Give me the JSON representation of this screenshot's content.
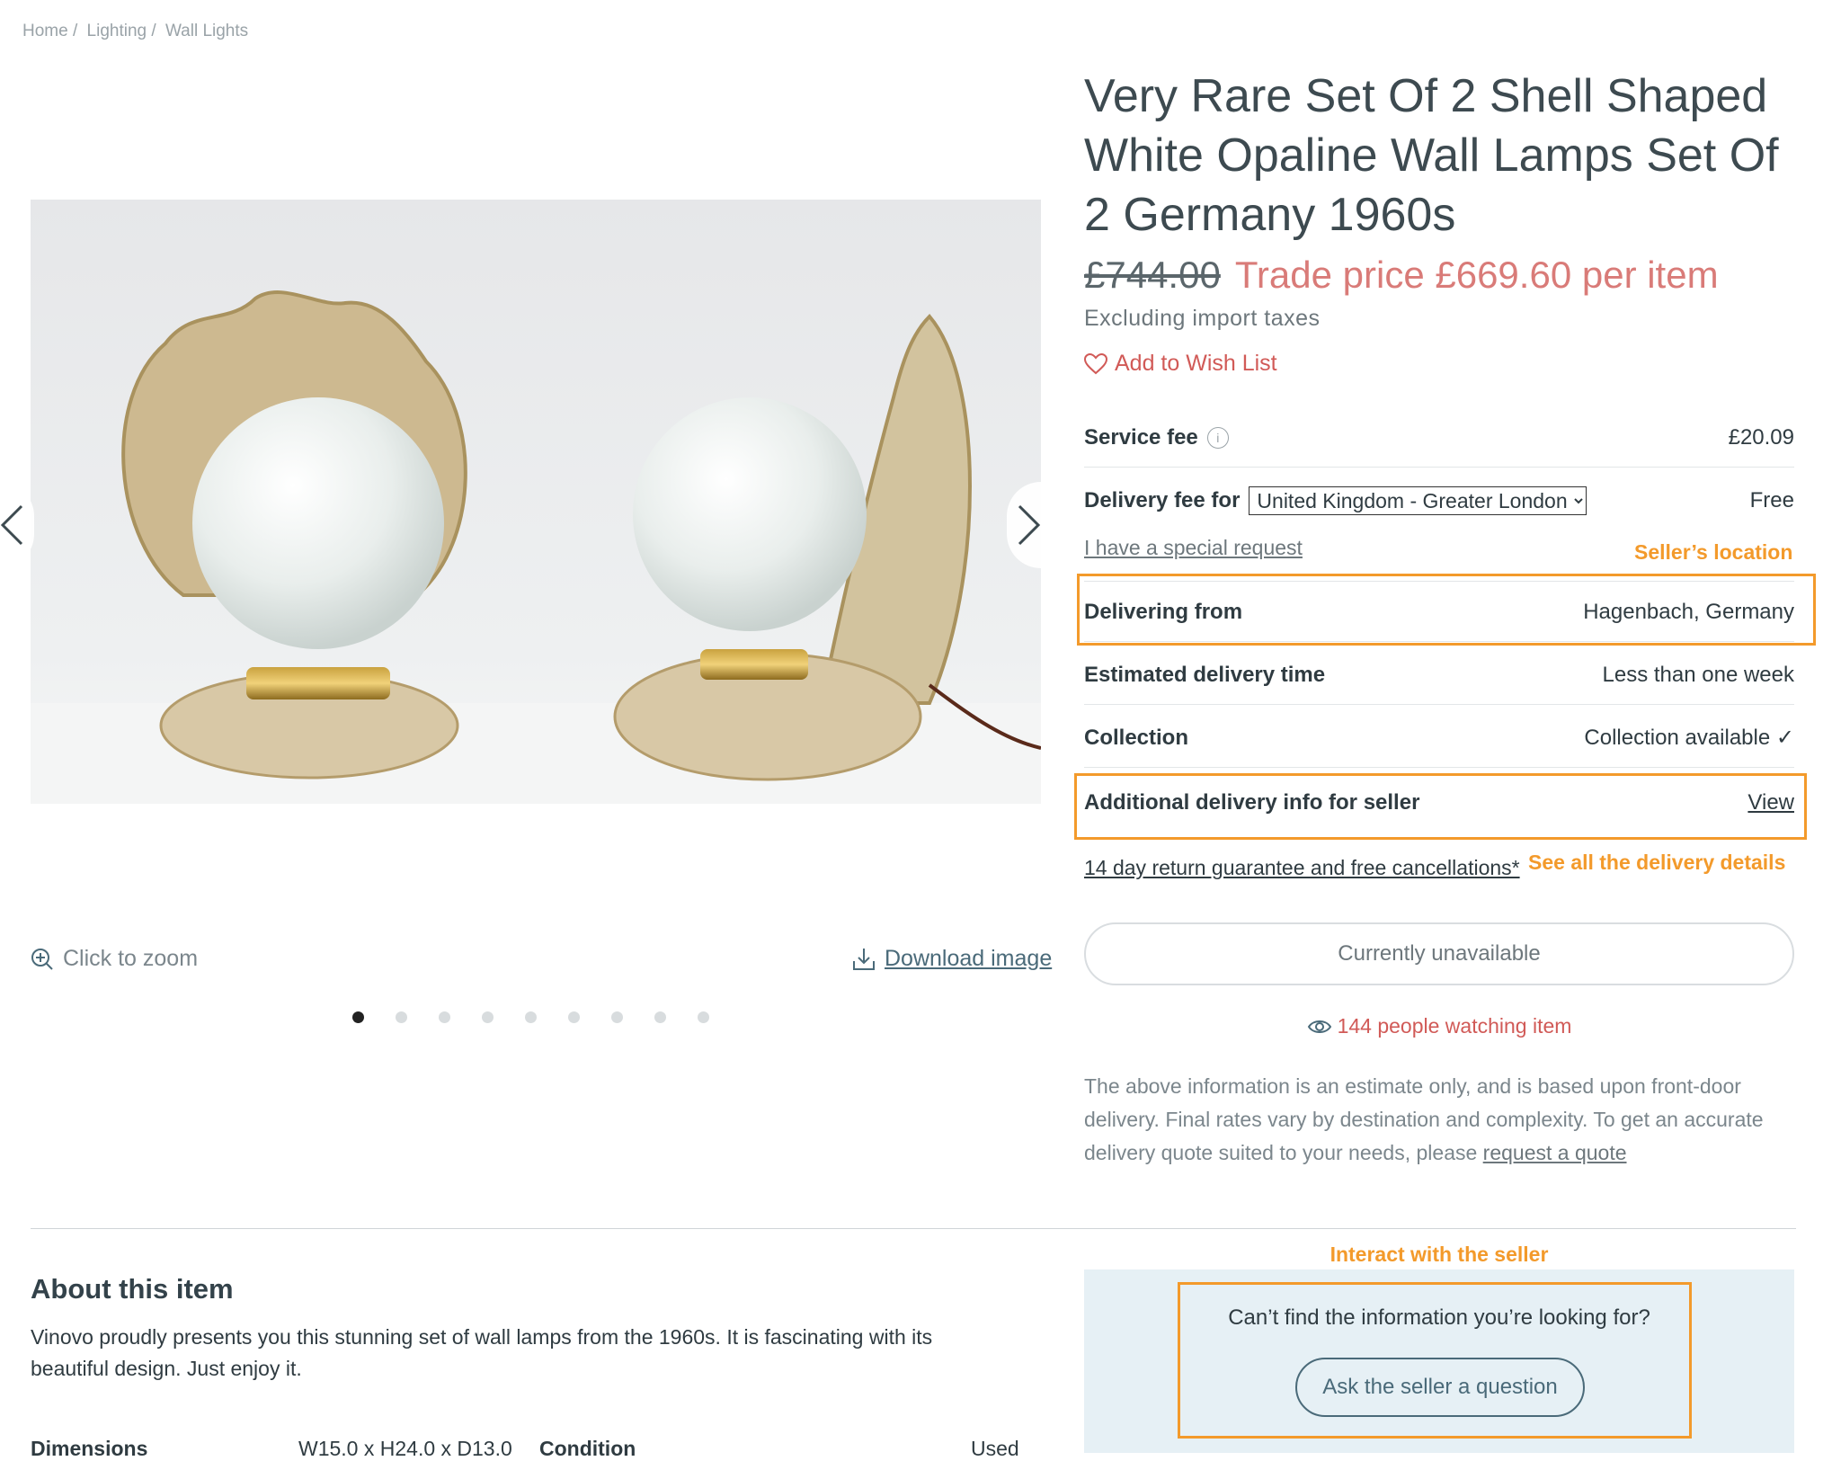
{
  "breadcrumb": [
    "Home /",
    "Lighting /",
    "Wall Lights"
  ],
  "product": {
    "title": "Very Rare Set Of 2 Shell Shaped White Opaline Wall Lamps Set Of 2 Germany 1960s",
    "old_price": "£744.00",
    "trade_price": "Trade price £669.60 per item",
    "tax_note": "Excluding import taxes",
    "wishlist": "Add to Wish List"
  },
  "gallery": {
    "zoom_label": "Click to zoom",
    "download_label": "Download image",
    "dot_count": 9,
    "active_dot": 0
  },
  "fees": {
    "service_fee_label": "Service fee",
    "service_fee_value": "£20.09",
    "delivery_fee_label": "Delivery fee for",
    "delivery_country": "United Kingdom - Greater London",
    "delivery_fee_value": "Free",
    "special_request": "I have a special request",
    "delivering_from_label": "Delivering from",
    "delivering_from_value": "Hagenbach, Germany",
    "est_time_label": "Estimated delivery time",
    "est_time_value": "Less than one week",
    "collection_label": "Collection",
    "collection_value": "Collection available ✓",
    "additional_label": "Additional delivery info for seller",
    "additional_value": "View",
    "return_link": "14 day return guarantee and free cancellations*"
  },
  "annotations": {
    "seller_location": "Seller’s location",
    "delivery_details": "See all the delivery details",
    "interact": "Interact with the seller",
    "color": "#f39a2b"
  },
  "actions": {
    "unavailable": "Currently unavailable",
    "watching": "144 people watching item"
  },
  "disclaimer": {
    "text": "The above information is an estimate only, and is based upon front-door delivery. Final rates vary by destination and complexity. To get an accurate delivery quote suited to your needs, please ",
    "link": "request a quote"
  },
  "about": {
    "title": "About this item",
    "text": "Vinovo proudly presents you this stunning set of wall lamps from the 1960s. It is fascinating with its beautiful design. Just enjoy it.",
    "dimensions_label": "Dimensions",
    "dimensions_value": "W15.0 x H24.0 x D13.0",
    "condition_label": "Condition",
    "condition_value": "Used"
  },
  "ask": {
    "question": "Can’t find the information you’re looking for?",
    "button": "Ask the seller a question"
  },
  "colors": {
    "accent_red": "#d97b78",
    "link_red": "#d15a57",
    "annotation_orange": "#f39a2b",
    "panel_blue": "#e6f0f5"
  }
}
